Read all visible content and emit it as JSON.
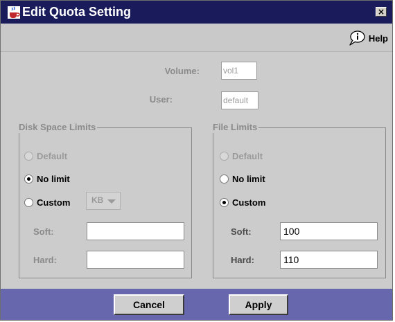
{
  "window": {
    "title": "Edit Quota Setting",
    "app_icon": "java-cup-icon",
    "close_label": "×"
  },
  "help": {
    "label": "Help",
    "icon": "info-bubble-icon"
  },
  "volume": {
    "label": "Volume:",
    "value": "vol1"
  },
  "user": {
    "label": "User:",
    "value": "default"
  },
  "disk": {
    "legend": "Disk Space Limits",
    "options": [
      "Default",
      "No limit",
      "Custom"
    ],
    "selected": "No limit",
    "unit": "KB",
    "soft_label": "Soft:",
    "soft_value": "",
    "hard_label": "Hard:",
    "hard_value": ""
  },
  "file": {
    "legend": "File Limits",
    "options": [
      "Default",
      "No limit",
      "Custom"
    ],
    "selected": "Custom",
    "soft_label": "Soft:",
    "soft_value": "100",
    "hard_label": "Hard:",
    "hard_value": "110"
  },
  "buttons": {
    "cancel": "Cancel",
    "apply": "Apply"
  },
  "colors": {
    "titlebar": "#1a1b5a",
    "footer": "#6667ad",
    "dialog_bg": "#cccccc"
  }
}
